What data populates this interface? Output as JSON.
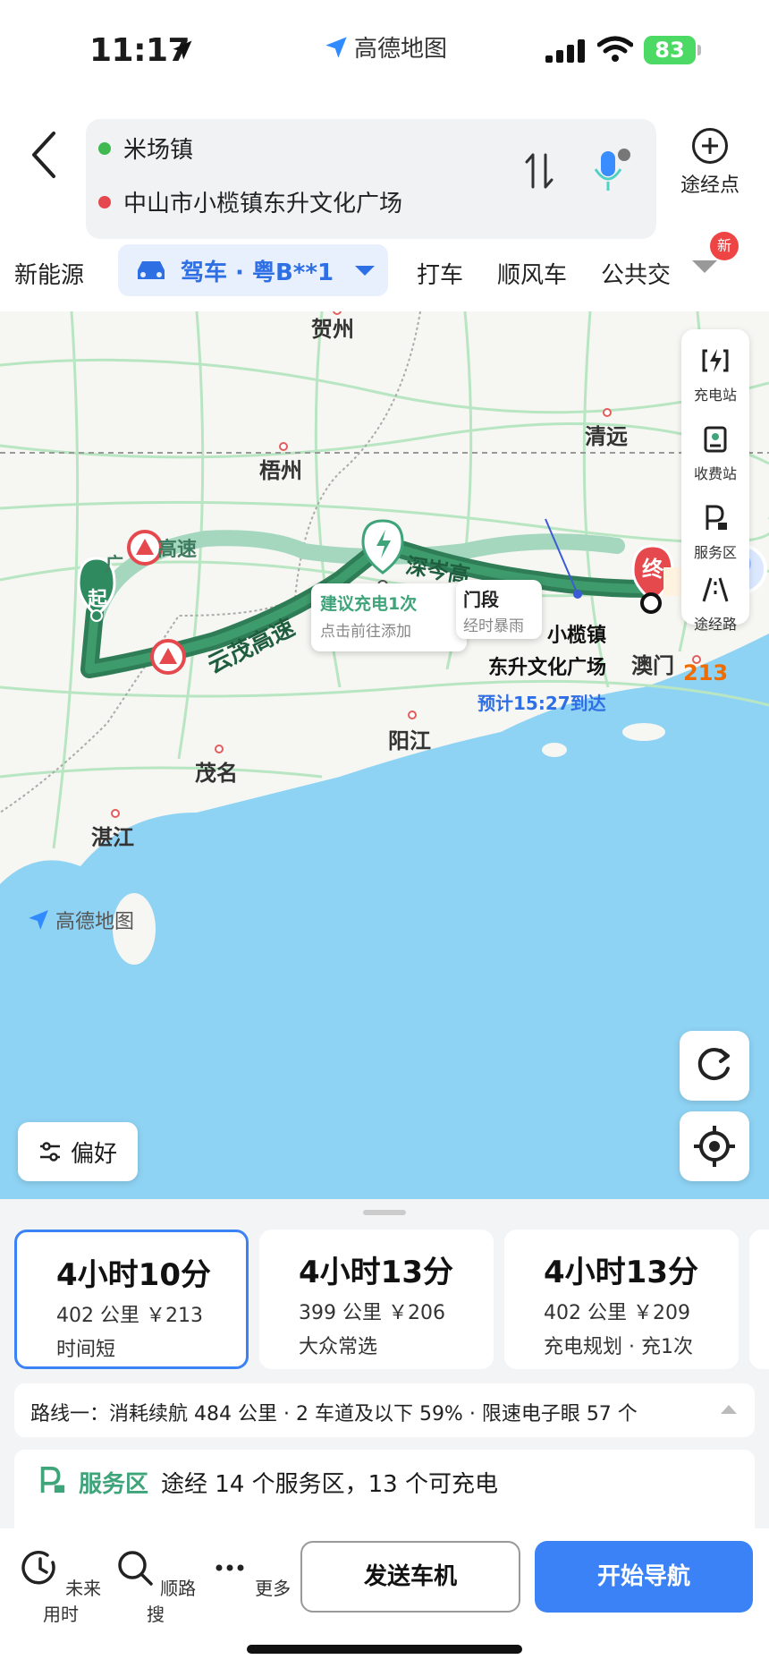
{
  "status": {
    "time": "11:17",
    "app_name": "高德地图",
    "battery": "83"
  },
  "header": {
    "origin": "米场镇",
    "destination": "中山市小榄镇东升文化广场",
    "waypoint_label": "途经点",
    "modes": {
      "new_energy": "新能源",
      "drive": "驾车 · 粤B**1",
      "taxi": "打车",
      "carpool": "顺风车",
      "transit": "公共交",
      "new_badge": "新"
    }
  },
  "map": {
    "cities": {
      "hezhou": "贺州",
      "wuzhou": "梧州",
      "qingyuan": "清远",
      "macau": "澳门",
      "yangjiang": "阳江",
      "maoming": "茂名",
      "zhanjiang": "湛江"
    },
    "tools": {
      "charging": "充电站",
      "toll": "收费站",
      "service": "服务区",
      "waypoint_road": "途经路"
    },
    "charge_tip": {
      "title": "建议充电1次",
      "subtitle": "点击前往添加"
    },
    "rain_tip": {
      "title": "门段",
      "subtitle": "经时暴雨"
    },
    "dest_label_1": "小榄镇",
    "dest_label_2": "东升文化广场",
    "eta": "预计15:27到达",
    "roads": {
      "r1": "云茂高速",
      "r2": "深岑高",
      "r3": "高速",
      "r4": "广"
    },
    "start_marker": "起",
    "end_marker": "终",
    "cost_chip": "213",
    "watermark": "高德地图",
    "pref_label": "偏好"
  },
  "routes": [
    {
      "duration": "4小时10分",
      "meta": "402 公里 ￥213",
      "tag": "时间短"
    },
    {
      "duration": "4小时13分",
      "meta": "399 公里 ￥206",
      "tag": "大众常选"
    },
    {
      "duration": "4小时13分",
      "meta": "402 公里 ￥209",
      "tag": "充电规划 · 充1次"
    }
  ],
  "route_info": "路线一：消耗续航 484 公里 · 2 车道及以下 59% · 限速电子眼 57 个",
  "service": {
    "title": "服务区",
    "text": "途经 14 个服务区，13 个可充电"
  },
  "bottombar": {
    "future": "未来用时",
    "search": "顺路搜",
    "more": "更多",
    "send": "发送车机",
    "navigate": "开始导航"
  },
  "colors": {
    "accent": "#3b82f6",
    "route_green": "#2f7d57",
    "water": "#8fd3f4"
  }
}
